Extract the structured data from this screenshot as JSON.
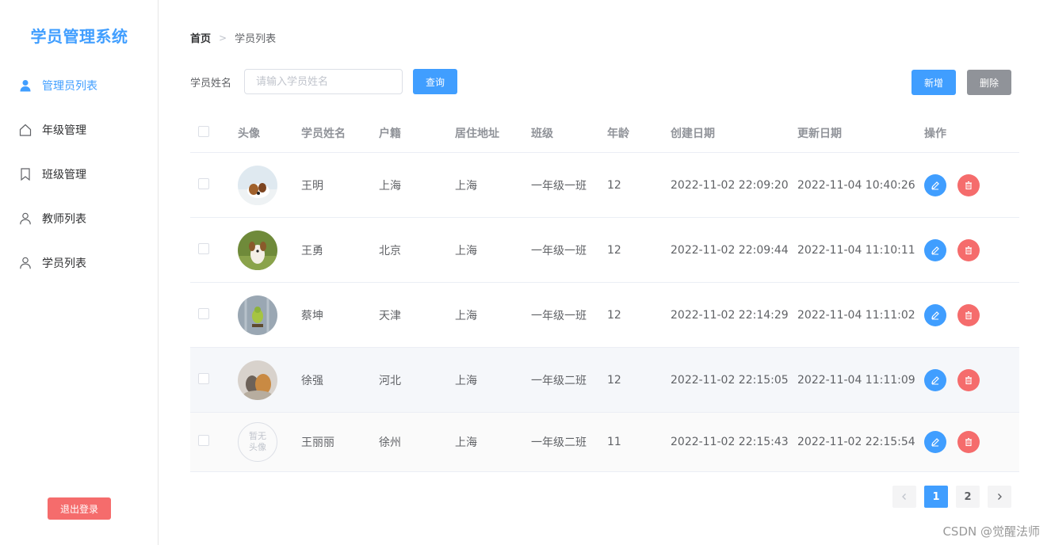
{
  "sidebar": {
    "title": "学员管理系统",
    "items": [
      {
        "label": "管理员列表",
        "icon": "user-icon",
        "active": true
      },
      {
        "label": "年级管理",
        "icon": "home-icon"
      },
      {
        "label": "班级管理",
        "icon": "bookmark-icon"
      },
      {
        "label": "教师列表",
        "icon": "user-outline-icon"
      },
      {
        "label": "学员列表",
        "icon": "user-outline-icon"
      }
    ],
    "logout_label": "退出登录"
  },
  "breadcrumb": {
    "home": "首页",
    "separator": ">",
    "current": "学员列表"
  },
  "search": {
    "label": "学员姓名",
    "placeholder": "请输入学员姓名",
    "value": "",
    "query_label": "查询"
  },
  "toolbar": {
    "add_label": "新增",
    "delete_label": "删除"
  },
  "table": {
    "headers": [
      "头像",
      "学员姓名",
      "户籍",
      "居住地址",
      "班级",
      "年龄",
      "创建日期",
      "更新日期",
      "操作"
    ],
    "rows": [
      {
        "avatar": "dog-photo",
        "name": "王明",
        "origin": "上海",
        "address": "上海",
        "class": "一年级一班",
        "age": "12",
        "created": "2022-11-02 22:09:20",
        "updated": "2022-11-04 10:40:26"
      },
      {
        "avatar": "puppy-photo",
        "name": "王勇",
        "origin": "北京",
        "address": "上海",
        "class": "一年级一班",
        "age": "12",
        "created": "2022-11-02 22:09:44",
        "updated": "2022-11-04 11:10:11"
      },
      {
        "avatar": "bird-photo",
        "name": "蔡坤",
        "origin": "天津",
        "address": "上海",
        "class": "一年级一班",
        "age": "12",
        "created": "2022-11-02 22:14:29",
        "updated": "2022-11-04 11:11:02"
      },
      {
        "avatar": "cat-dog-photo",
        "name": "徐强",
        "origin": "河北",
        "address": "上海",
        "class": "一年级二班",
        "age": "12",
        "created": "2022-11-02 22:15:05",
        "updated": "2022-11-04 11:11:09"
      },
      {
        "avatar": "no-avatar",
        "avatar_text": "暂无头像",
        "name": "王丽丽",
        "origin": "徐州",
        "address": "上海",
        "class": "一年级二班",
        "age": "11",
        "created": "2022-11-02 22:15:43",
        "updated": "2022-11-02 22:15:54"
      }
    ]
  },
  "pagination": {
    "pages": [
      "1",
      "2"
    ],
    "current": "1"
  },
  "watermark": "CSDN @觉醒法师",
  "colors": {
    "primary": "#409eff",
    "danger": "#f56c6c",
    "info": "#909399"
  }
}
